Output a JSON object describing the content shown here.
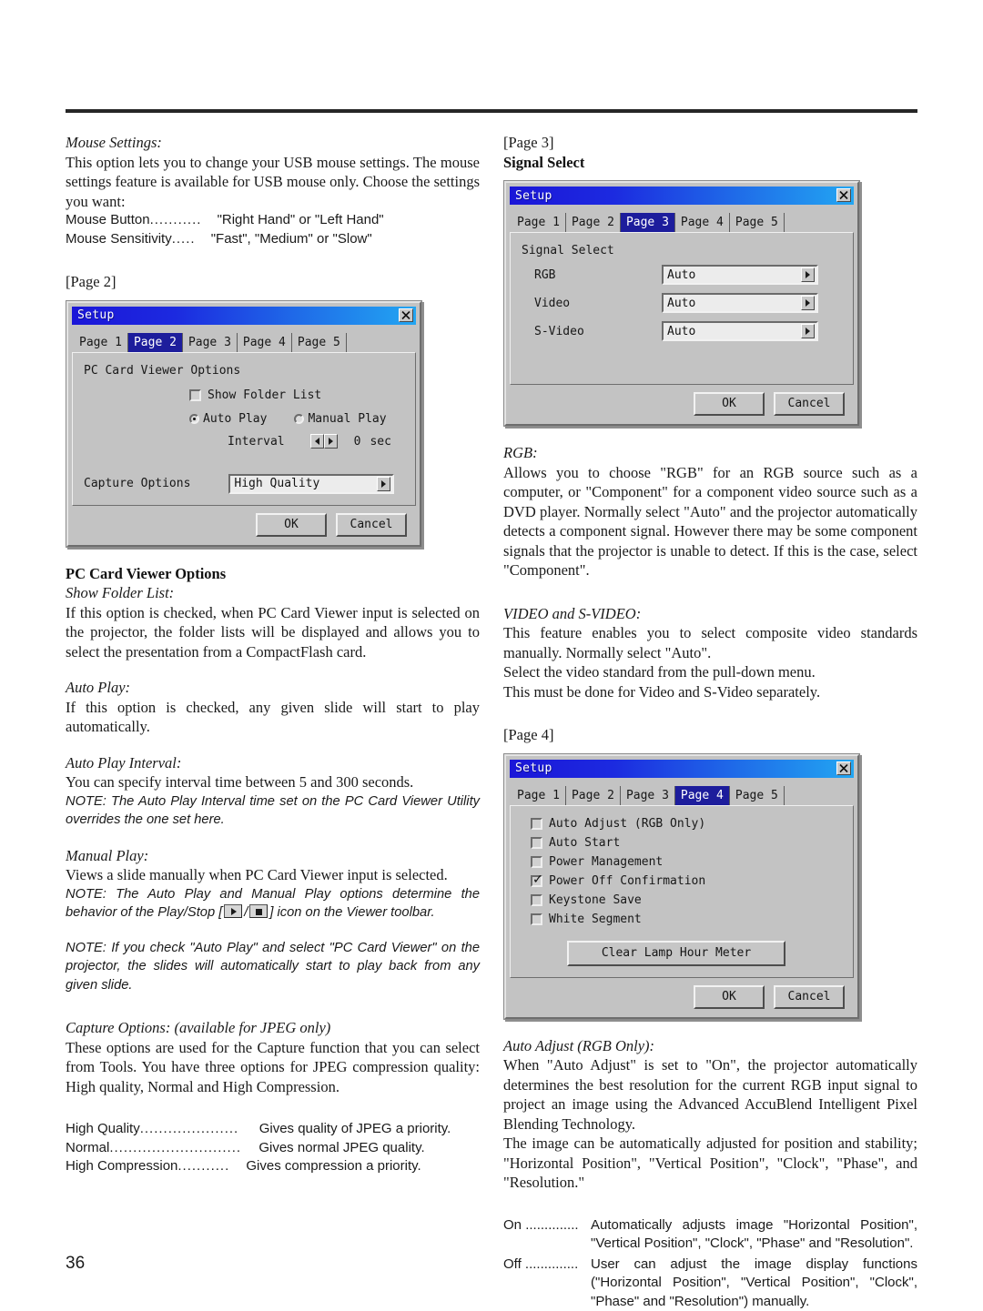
{
  "document": {
    "page_number": "36"
  },
  "left_column": {
    "mouse_settings": {
      "heading": "Mouse Settings:",
      "body": "This option lets you to change your USB mouse settings. The mouse settings feature is available for USB mouse only. Choose the settings you want:",
      "rows": [
        {
          "name": "Mouse Button",
          "dots": "...........",
          "value": "\"Right Hand\" or \"Left Hand\""
        },
        {
          "name": "Mouse Sensitivity",
          "dots": ".....",
          "value": "\"Fast\", \"Medium\" or \"Slow\""
        }
      ]
    },
    "page2_label": "[Page 2]",
    "pc_card_viewer_options": {
      "heading": "PC Card Viewer Options",
      "show_folder_list": {
        "heading": "Show Folder List:",
        "body": "If this option is checked, when PC Card Viewer input is selected on the projector, the folder lists will be displayed and allows you to select the presentation from a CompactFlash card."
      },
      "auto_play": {
        "heading": "Auto Play:",
        "body": "If this option is checked, any given slide will start to play automatically."
      },
      "auto_play_interval": {
        "heading": "Auto Play Interval:",
        "body": "You can specify interval time between 5 and 300 seconds.",
        "note": "NOTE: The Auto Play Interval time set on the PC Card Viewer Utility overrides the one set here."
      },
      "manual_play": {
        "heading": "Manual Play:",
        "body": "Views a slide manually when PC Card Viewer input is selected.",
        "note_part1": "NOTE: The Auto Play and Manual Play options determine the behavior of the Play/Stop [",
        "note_sep": "/",
        "note_part2": "] icon on the Viewer toolbar."
      },
      "note_autoplay": "NOTE: If you check \"Auto Play\" and select \"PC Card Viewer\" on the projector, the slides will automatically start to play back from any given slide."
    },
    "capture_options": {
      "heading": "Capture Options: (available for JPEG only)",
      "body": "These options are used for the Capture function that you can select from Tools. You have three options for JPEG compression quality: High quality, Normal and High Compression.",
      "rows": [
        {
          "name": "High Quality",
          "dots": ".....................",
          "value": "Gives quality of JPEG a priority."
        },
        {
          "name": "Normal",
          "dots": "............................",
          "value": "Gives normal JPEG quality."
        },
        {
          "name": "High Compression",
          "dots": "...........",
          "value": "Gives compression a priority."
        }
      ]
    }
  },
  "right_column": {
    "page3_label": "[Page 3]",
    "signal_select_heading": "Signal Select",
    "rgb": {
      "heading": "RGB:",
      "body": "Allows you to choose \"RGB\" for an RGB source such as a computer, or \"Component\" for a component video source such as a DVD player. Normally select \"Auto\" and the projector automatically detects a component signal. However there may be some component signals that the projector is unable to detect. If this is the case, select \"Component\"."
    },
    "video_svideo": {
      "heading": "VIDEO and S-VIDEO:",
      "line1": "This feature enables you to select composite video standards manually. Normally select \"Auto\".",
      "line2": "Select the video standard from the pull-down menu.",
      "line3": "This must be done for Video and S-Video separately."
    },
    "page4_label": "[Page 4]",
    "auto_adjust": {
      "heading": "Auto Adjust (RGB Only):",
      "para1": "When \"Auto Adjust\" is set to \"On\", the projector automatically determines the best resolution for the current RGB input signal to project an image using the Advanced AccuBlend Intelligent Pixel Blending Technology.",
      "para2": "The image can be automatically adjusted for position and stability; \"Horizontal Position\", \"Vertical Position\", \"Clock\", \"Phase\", and \"Resolution.\"",
      "rows": [
        {
          "key": "On",
          "dots": "..............",
          "text": "Automatically adjusts image \"Horizontal Position\", \"Vertical Position\", \"Clock\", \"Phase\" and \"Resolution\"."
        },
        {
          "key": "Off",
          "dots": "..............",
          "text": "User can adjust the image display functions (\"Horizontal Position\", \"Vertical Position\", \"Clock\", \"Phase\" and \"Resolution\") manually."
        }
      ]
    }
  },
  "dialogs": {
    "page2": {
      "title": "Setup",
      "close_icon": "close-icon",
      "tabs": [
        {
          "label": "Page 1",
          "active": false
        },
        {
          "label": "Page 2",
          "active": true
        },
        {
          "label": "Page 3",
          "active": false
        },
        {
          "label": "Page 4",
          "active": false
        },
        {
          "label": "Page 5",
          "active": false
        }
      ],
      "group_label": "PC Card Viewer Options",
      "show_folder_list_label": "Show Folder List",
      "show_folder_list_checked": false,
      "auto_play_label": "Auto Play",
      "auto_play_selected": true,
      "manual_play_label": "Manual Play",
      "manual_play_selected": false,
      "interval_label": "Interval",
      "interval_value": "0",
      "interval_unit": "sec",
      "capture_options_label": "Capture Options",
      "capture_options_value": "High Quality",
      "ok_label": "OK",
      "cancel_label": "Cancel"
    },
    "page3": {
      "title": "Setup",
      "close_icon": "close-icon",
      "tabs": [
        {
          "label": "Page 1",
          "active": false
        },
        {
          "label": "Page 2",
          "active": false
        },
        {
          "label": "Page 3",
          "active": true
        },
        {
          "label": "Page 4",
          "active": false
        },
        {
          "label": "Page 5",
          "active": false
        }
      ],
      "group_label": "Signal Select",
      "fields": [
        {
          "label": "RGB",
          "value": "Auto"
        },
        {
          "label": "Video",
          "value": "Auto"
        },
        {
          "label": "S-Video",
          "value": "Auto"
        }
      ],
      "ok_label": "OK",
      "cancel_label": "Cancel"
    },
    "page4": {
      "title": "Setup",
      "close_icon": "close-icon",
      "tabs": [
        {
          "label": "Page 1",
          "active": false
        },
        {
          "label": "Page 2",
          "active": false
        },
        {
          "label": "Page 3",
          "active": false
        },
        {
          "label": "Page 4",
          "active": true
        },
        {
          "label": "Page 5",
          "active": false
        }
      ],
      "checkboxes": [
        {
          "label": "Auto Adjust (RGB Only)",
          "checked": false
        },
        {
          "label": "Auto Start",
          "checked": false
        },
        {
          "label": "Power Management",
          "checked": false
        },
        {
          "label": "Power Off Confirmation",
          "checked": true
        },
        {
          "label": "Keystone Save",
          "checked": false
        },
        {
          "label": "White Segment",
          "checked": false
        }
      ],
      "clear_lamp_label": "Clear Lamp Hour Meter",
      "ok_label": "OK",
      "cancel_label": "Cancel"
    }
  },
  "colors": {
    "titlebar_start": "#1b16d8",
    "titlebar_end": "#22a6f2",
    "active_tab": "#1d1d9c",
    "dialog_face": "#c3c3c3"
  }
}
